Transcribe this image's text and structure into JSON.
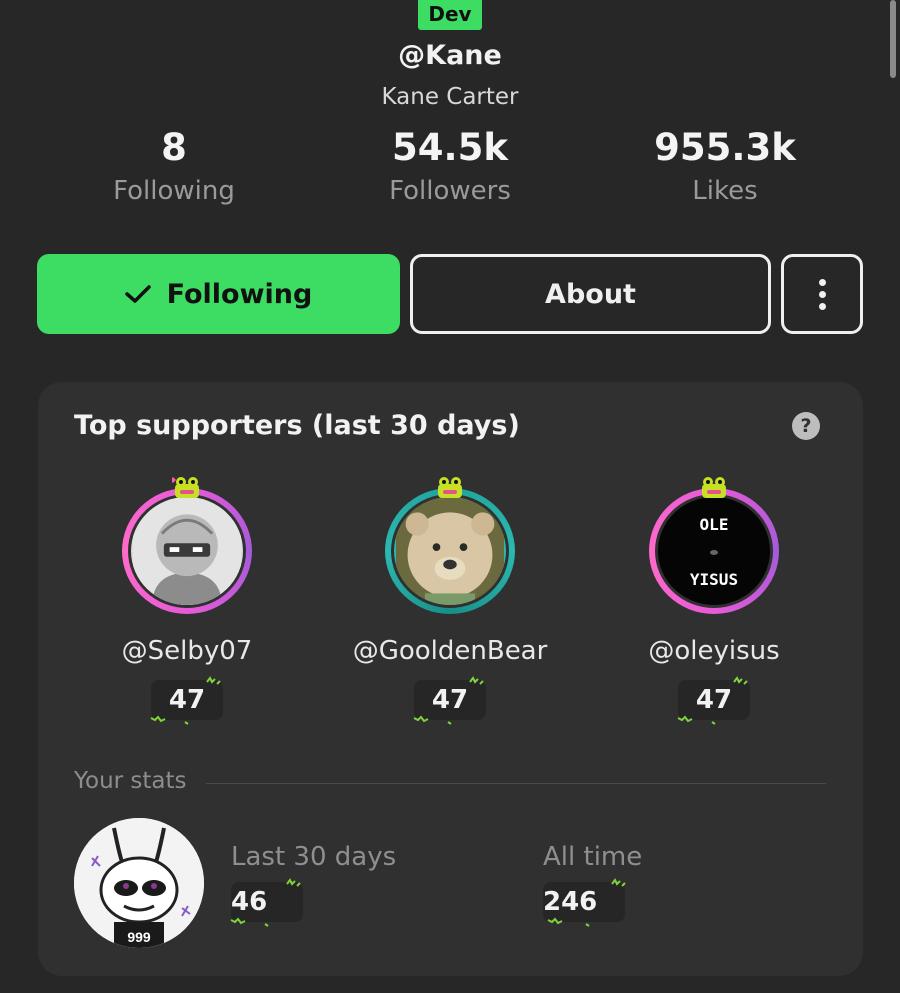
{
  "profile": {
    "badge": "Dev",
    "handle": "@Kane",
    "full_name": "Kane Carter"
  },
  "stats": {
    "following_count": "8",
    "following_label": "Following",
    "followers_count": "54.5k",
    "followers_label": "Followers",
    "likes_count": "955.3k",
    "likes_label": "Likes"
  },
  "actions": {
    "following_label": "Following",
    "about_label": "About"
  },
  "supporters": {
    "title": "Top supporters (last 30 days)",
    "help_icon": "question-icon",
    "items": [
      {
        "name": "@Selby07",
        "points": "47"
      },
      {
        "name": "@GooldenBear",
        "points": "47"
      },
      {
        "name": "@oleyisus",
        "points": "47",
        "avatar_text_top": "OLE",
        "avatar_text_bottom": "YISUS"
      }
    ]
  },
  "your_stats": {
    "label": "Your stats",
    "last_30_label": "Last 30 days",
    "last_30_value": "46",
    "all_time_label": "All time",
    "all_time_value": "246",
    "avatar_text": "999"
  },
  "colors": {
    "accent_green": "#3ddc63",
    "background": "#272727",
    "card": "#303030"
  }
}
